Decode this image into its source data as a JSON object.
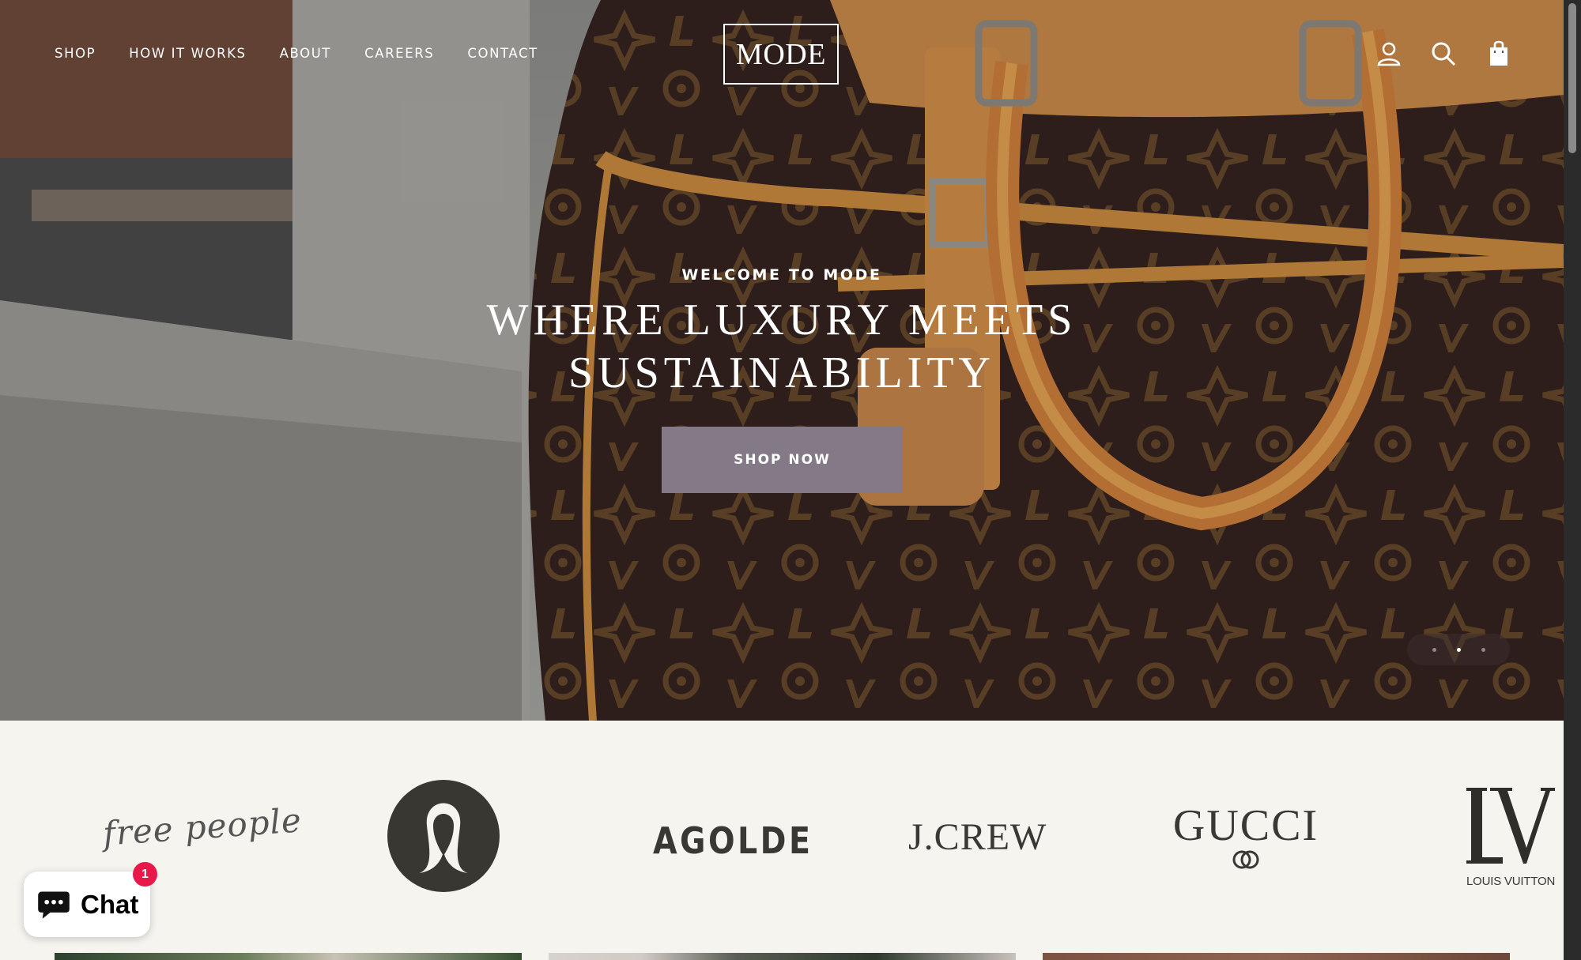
{
  "nav": {
    "items": [
      {
        "label": "SHOP"
      },
      {
        "label": "HOW IT WORKS"
      },
      {
        "label": "ABOUT"
      },
      {
        "label": "CAREERS"
      },
      {
        "label": "CONTACT"
      }
    ]
  },
  "logo": {
    "text": "MODE"
  },
  "header_icons": [
    "account-icon",
    "search-icon",
    "cart-icon"
  ],
  "hero": {
    "eyebrow": "WELCOME TO MODE",
    "headline_line1": "WHERE LUXURY MEETS",
    "headline_line2": "SUSTAINABILITY",
    "cta_label": "SHOP NOW",
    "slides_total": 3,
    "active_slide": 2
  },
  "brands": {
    "free_people": "free people",
    "agolde": "AGOLDE",
    "jcrew": "J.CREW",
    "gucci": "GUCCI",
    "lv_caption": "LOUIS VUITTON"
  },
  "chat": {
    "label": "Chat",
    "badge_count": "1"
  },
  "colors": {
    "cta": "#847987",
    "page_bg": "#f5f4ef",
    "badge": "#e8194a"
  }
}
